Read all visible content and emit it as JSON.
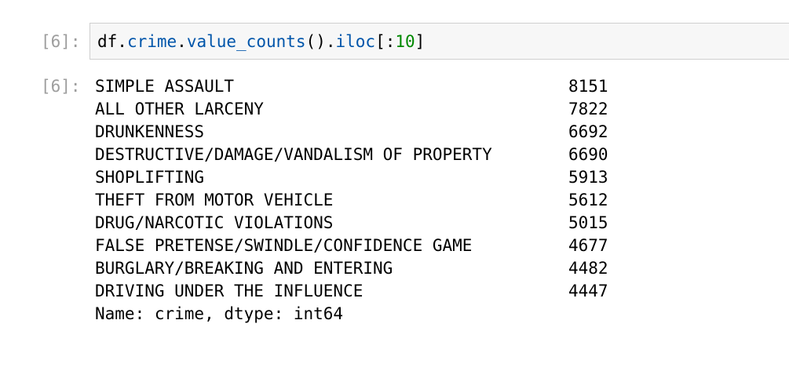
{
  "input_cell": {
    "prompt": "[6]:",
    "code": {
      "obj": "df",
      "dot1": ".",
      "attr1": "crime",
      "dot2": ".",
      "attr2": "value_counts",
      "call": "()",
      "dot3": ".",
      "attr3": "iloc",
      "open": "[:",
      "num": "10",
      "close": "]"
    }
  },
  "output_cell": {
    "prompt": "[6]:",
    "rows": [
      {
        "label": "SIMPLE ASSAULT",
        "value": "8151"
      },
      {
        "label": "ALL OTHER LARCENY",
        "value": "7822"
      },
      {
        "label": "DRUNKENNESS",
        "value": "6692"
      },
      {
        "label": "DESTRUCTIVE/DAMAGE/VANDALISM OF PROPERTY",
        "value": "6690"
      },
      {
        "label": "SHOPLIFTING",
        "value": "5913"
      },
      {
        "label": "THEFT FROM MOTOR VEHICLE",
        "value": "5612"
      },
      {
        "label": "DRUG/NARCOTIC VIOLATIONS",
        "value": "5015"
      },
      {
        "label": "FALSE PRETENSE/SWINDLE/CONFIDENCE GAME",
        "value": "4677"
      },
      {
        "label": "BURGLARY/BREAKING AND ENTERING",
        "value": "4482"
      },
      {
        "label": "DRIVING UNDER THE INFLUENCE",
        "value": "4447"
      }
    ],
    "footer": "Name: crime, dtype: int64"
  }
}
